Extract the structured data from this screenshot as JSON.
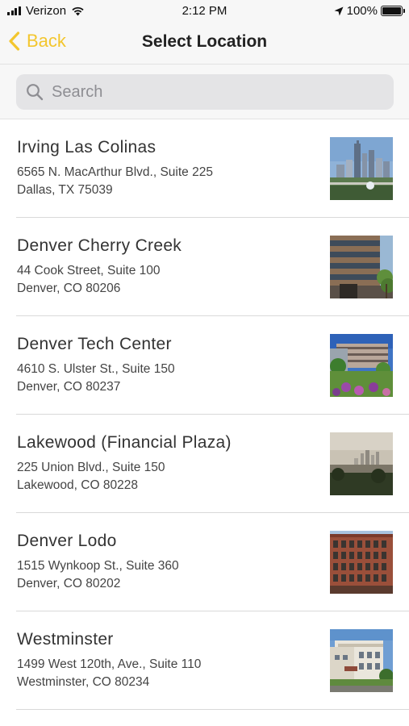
{
  "status_bar": {
    "carrier": "Verizon",
    "time": "2:12 PM",
    "battery": "100%",
    "icons": [
      "signal-icon",
      "wifi-icon",
      "location-arrow-icon",
      "battery-icon"
    ]
  },
  "nav": {
    "back_label": "Back",
    "title": "Select Location",
    "accent_color": "#f3c62e"
  },
  "search": {
    "placeholder": "Search",
    "value": ""
  },
  "locations": [
    {
      "name": "Irving Las Colinas",
      "street": "6565 N. MacArthur Blvd., Suite 225",
      "city": "Dallas, TX 75039",
      "photo": "city-skyline-photo"
    },
    {
      "name": "Denver Cherry Creek",
      "street": "44 Cook Street, Suite 100",
      "city": "Denver, CO 80206",
      "photo": "office-building-photo"
    },
    {
      "name": "Denver Tech Center",
      "street": "4610 S. Ulster St., Suite 150",
      "city": "Denver, CO 80237",
      "photo": "office-building-garden-photo"
    },
    {
      "name": "Lakewood (Financial Plaza)",
      "street": "225 Union Blvd., Suite 150",
      "city": "Lakewood, CO 80228",
      "photo": "hazy-skyline-photo"
    },
    {
      "name": "Denver Lodo",
      "street": "1515 Wynkoop St., Suite 360",
      "city": "Denver, CO 80202",
      "photo": "brick-building-photo"
    },
    {
      "name": "Westminster",
      "street": "1499 West 120th, Ave., Suite 110",
      "city": "Westminster, CO 80234",
      "photo": "white-office-building-photo"
    }
  ]
}
